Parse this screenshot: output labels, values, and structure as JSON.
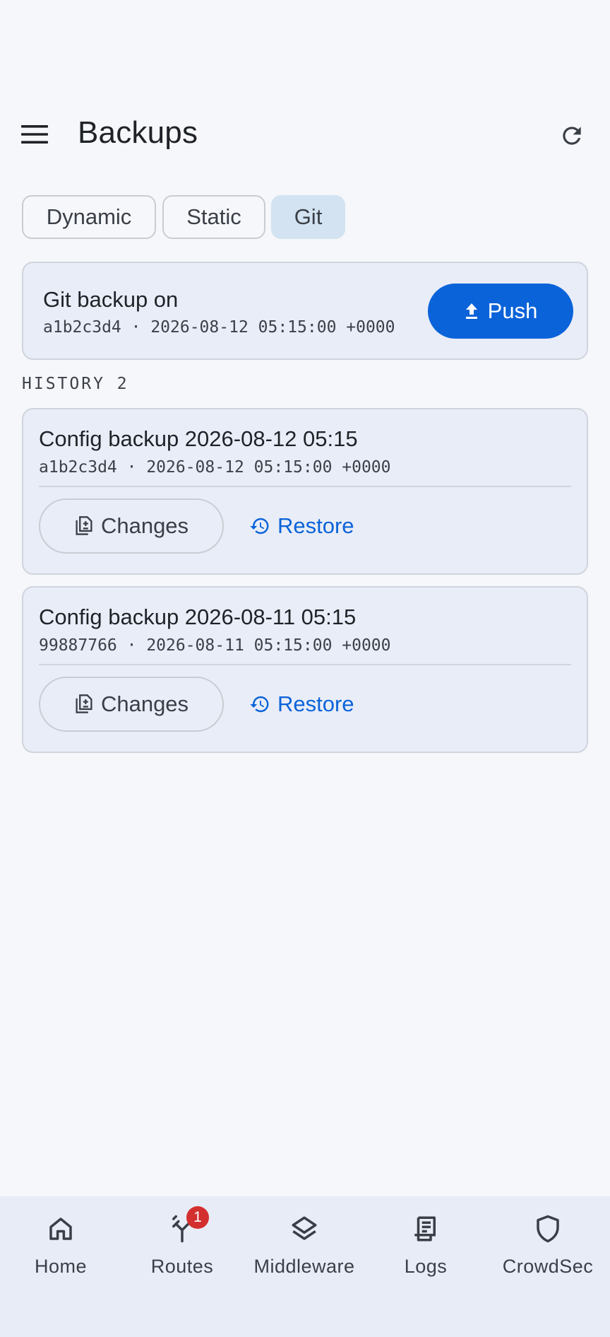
{
  "header": {
    "title": "Backups",
    "menu_icon": "hamburger-menu-icon",
    "refresh_icon": "refresh-icon"
  },
  "tabs": [
    {
      "label": "Dynamic",
      "active": false
    },
    {
      "label": "Static",
      "active": false
    },
    {
      "label": "Git",
      "active": true
    }
  ],
  "git_status": {
    "title": "Git backup on",
    "commit": "a1b2c3d4 · 2026-08-12 05:15:00 +0000",
    "push_label": "Push",
    "push_icon": "upload-icon"
  },
  "history": {
    "label": "HISTORY 2",
    "items": [
      {
        "title": "Config backup 2026-08-12 05:15",
        "commit": "a1b2c3d4 · 2026-08-12 05:15:00 +0000",
        "changes_label": "Changes",
        "restore_label": "Restore"
      },
      {
        "title": "Config backup 2026-08-11 05:15",
        "commit": "99887766 · 2026-08-11 05:15:00 +0000",
        "changes_label": "Changes",
        "restore_label": "Restore"
      }
    ]
  },
  "nav": {
    "items": [
      {
        "label": "Home",
        "icon": "home-icon"
      },
      {
        "label": "Routes",
        "icon": "routes-icon",
        "badge": "1"
      },
      {
        "label": "Middleware",
        "icon": "layers-icon"
      },
      {
        "label": "Logs",
        "icon": "receipt-icon"
      },
      {
        "label": "CrowdSec",
        "icon": "shield-icon"
      }
    ]
  },
  "colors": {
    "accent": "#0b63d9",
    "badge": "#d32f2f",
    "active_tab": "#d3e3f1",
    "card_bg": "#e9edf7"
  }
}
